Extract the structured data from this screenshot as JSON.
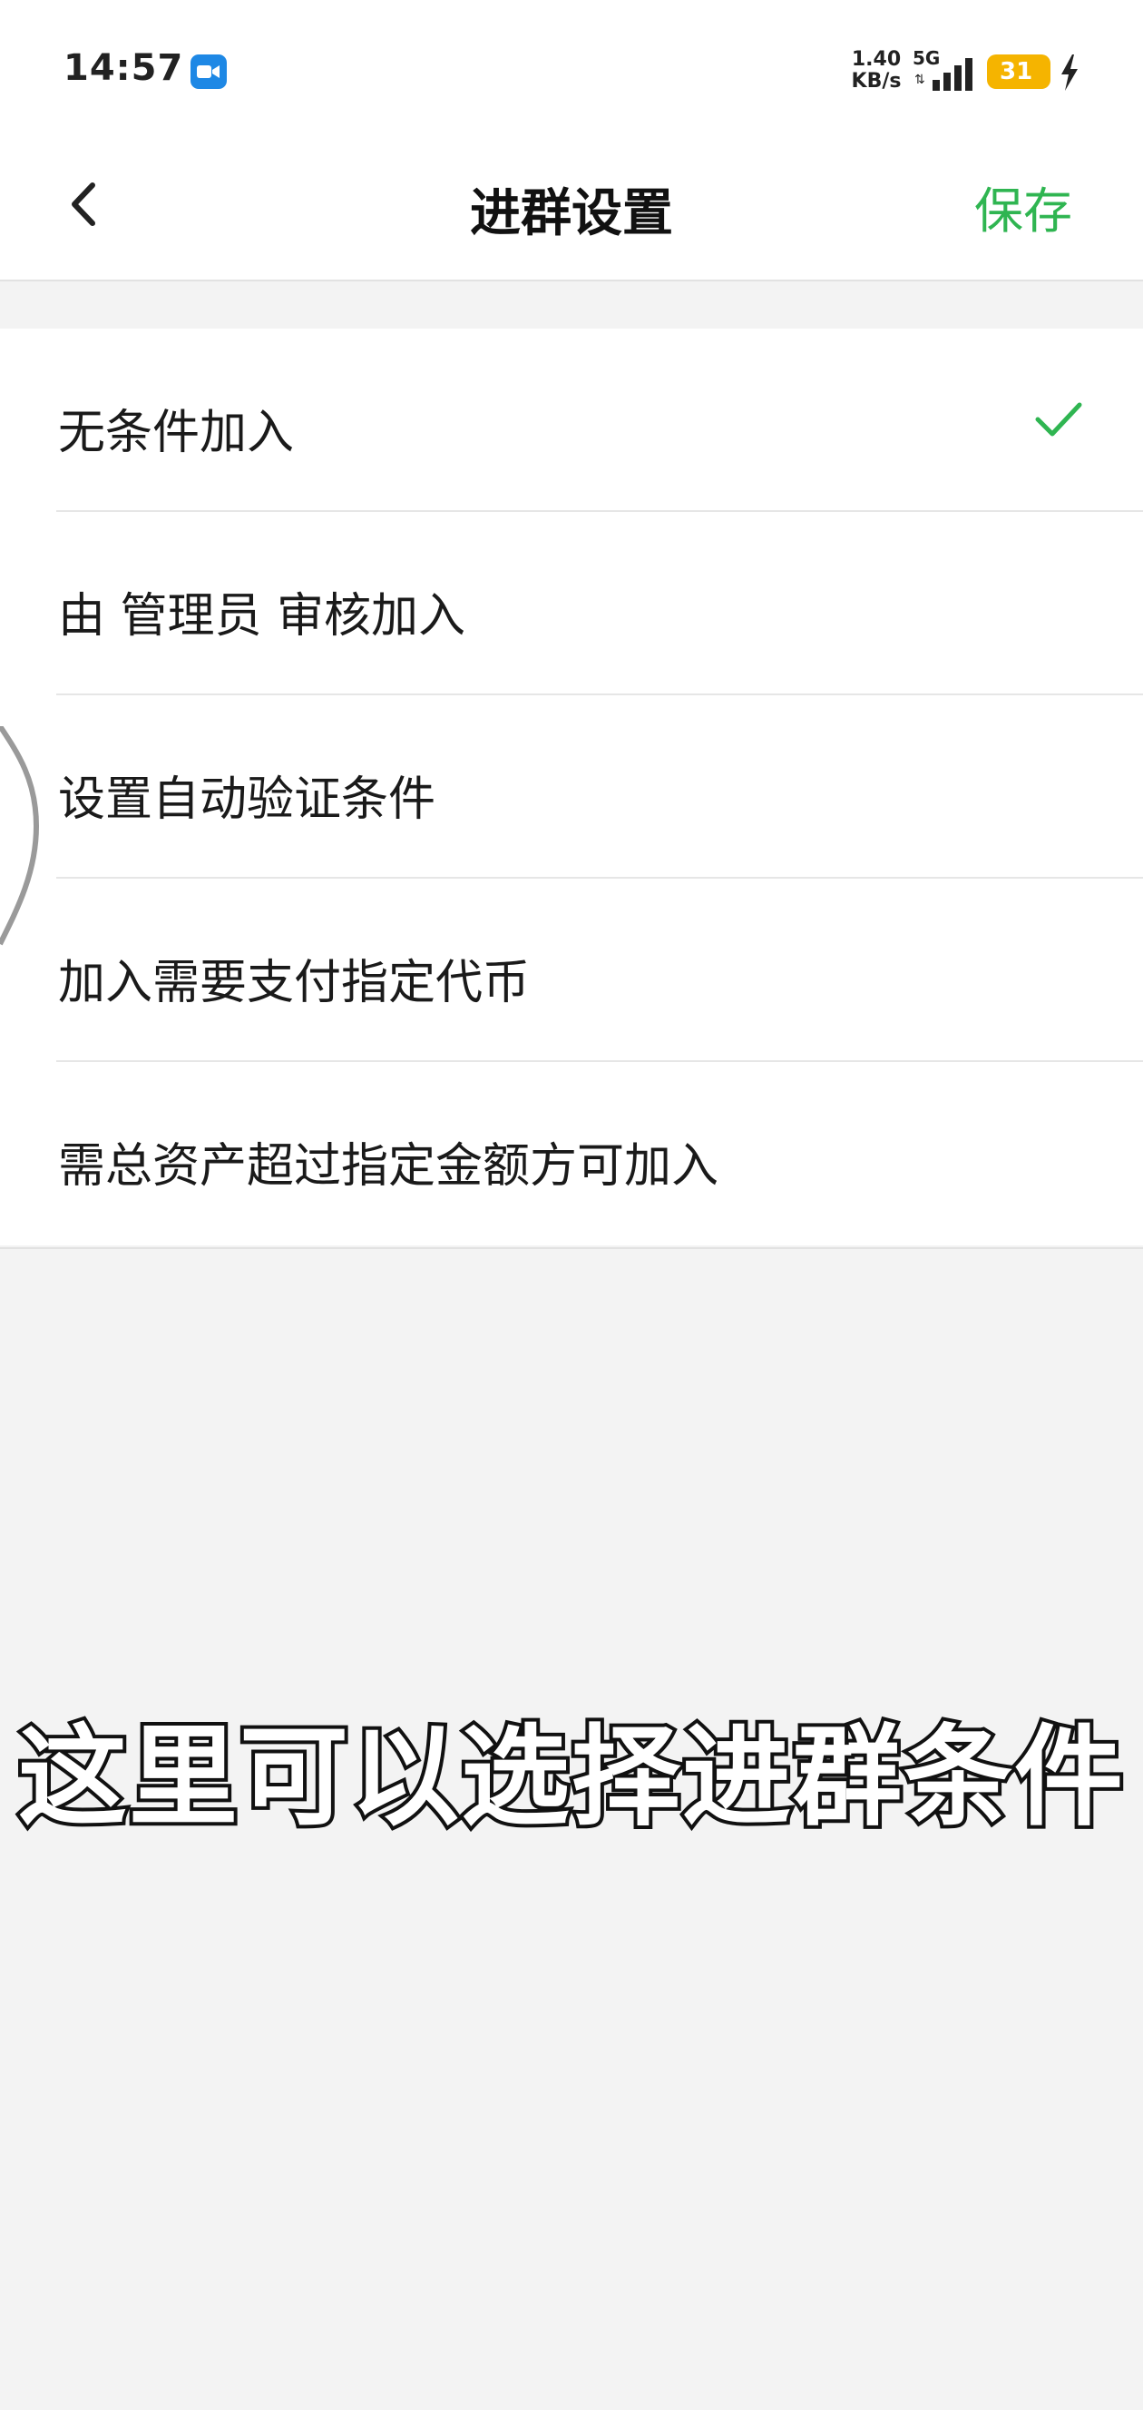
{
  "status_bar": {
    "time": "14:57",
    "net_speed_value": "1.40",
    "net_speed_unit": "KB/s",
    "network_type": "5G",
    "battery_level": "31",
    "icons": [
      "video-icon",
      "signal-icon",
      "battery-icon",
      "charging-icon"
    ]
  },
  "nav": {
    "title": "进群设置",
    "save_label": "保存",
    "back_icon": "chevron-left-icon",
    "accent_color": "#2fb551"
  },
  "options": [
    {
      "label": "无条件加入",
      "selected": true
    },
    {
      "label": "由 管理员 审核加入",
      "selected": false
    },
    {
      "label": "设置自动验证条件",
      "selected": false
    },
    {
      "label": "加入需要支付指定代币",
      "selected": false
    },
    {
      "label": "需总资产超过指定金额方可加入",
      "selected": false
    }
  ],
  "caption": "这里可以选择进群条件"
}
